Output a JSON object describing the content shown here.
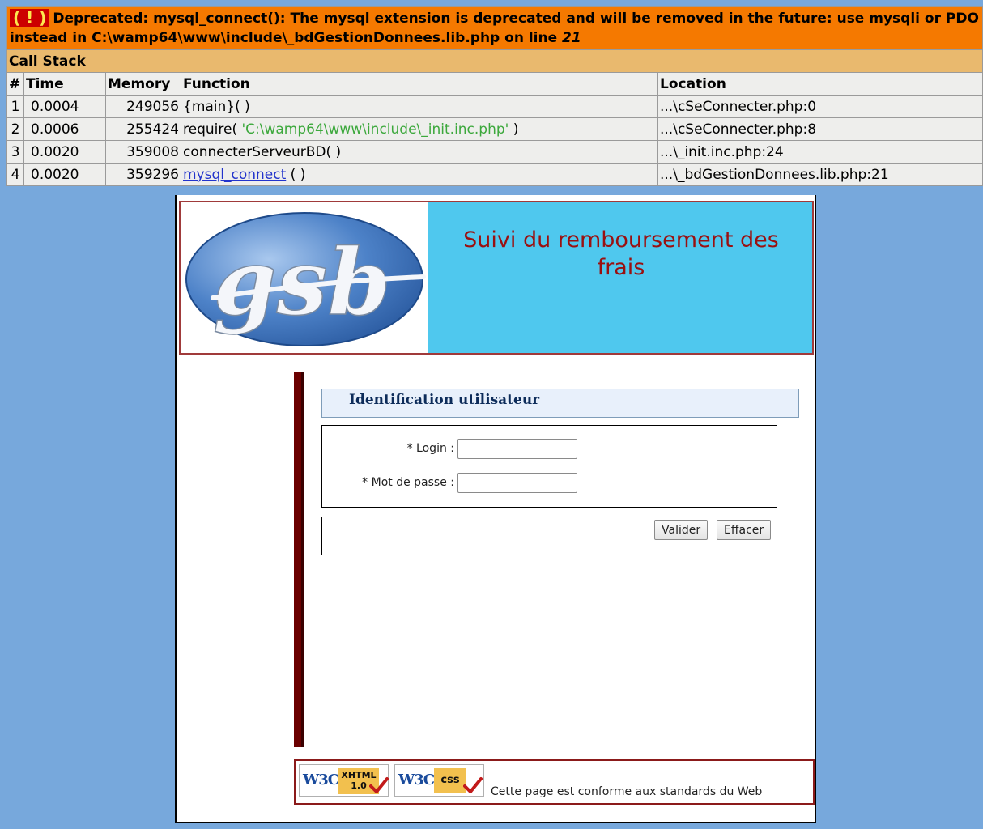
{
  "xdebug": {
    "badge": "( ! )",
    "message": "Deprecated: mysql_connect(): The mysql extension is deprecated and will be removed in the future: use mysqli or PDO instead in C:\\wamp64\\www\\include\\_bdGestionDonnees.lib.php on line ",
    "line_number": "21",
    "call_stack_title": "Call Stack",
    "columns": [
      "#",
      "Time",
      "Memory",
      "Function",
      "Location"
    ],
    "rows": [
      {
        "num": "1",
        "time": "0.0004",
        "memory": "249056",
        "func": "{main}( )",
        "func_arg": "",
        "func_tail": "",
        "location": "...\\cSeConnecter.php:0"
      },
      {
        "num": "2",
        "time": "0.0006",
        "memory": "255424",
        "func": "require( ",
        "func_arg": "'C:\\wamp64\\www\\include\\_init.inc.php'",
        "func_tail": " )",
        "location": "...\\cSeConnecter.php:8"
      },
      {
        "num": "3",
        "time": "0.0020",
        "memory": "359008",
        "func": "connecterServeurBD( )",
        "func_arg": "",
        "func_tail": "",
        "location": "...\\_init.inc.php:24"
      },
      {
        "num": "4",
        "time": "0.0020",
        "memory": "359296",
        "func_link": "mysql_connect",
        "func_tail": " ( )",
        "location": "...\\_bdGestionDonnees.lib.php:21"
      }
    ]
  },
  "header": {
    "logo_text": "gsb",
    "title_line1": "Suivi du remboursement des",
    "title_line2": "frais"
  },
  "login": {
    "section_title": "Identification utilisateur",
    "login_label": "* Login :",
    "login_value": "",
    "password_label": "* Mot de passe :",
    "password_value": "",
    "submit_label": "Valider",
    "reset_label": "Effacer"
  },
  "footer": {
    "badge_xhtml_w3c": "W3C",
    "badge_xhtml_tag": "XHTML",
    "badge_xhtml_version": "1.0",
    "badge_css_w3c": "W3C",
    "badge_css_tag": "css",
    "text": "Cette page est conforme aux standards du Web"
  },
  "colors": {
    "background": "#77a8dc",
    "error_header": "#f57900",
    "callstack_header": "#e9b96e",
    "title_red": "#9a1010",
    "header_cyan": "#4fc8ee"
  }
}
